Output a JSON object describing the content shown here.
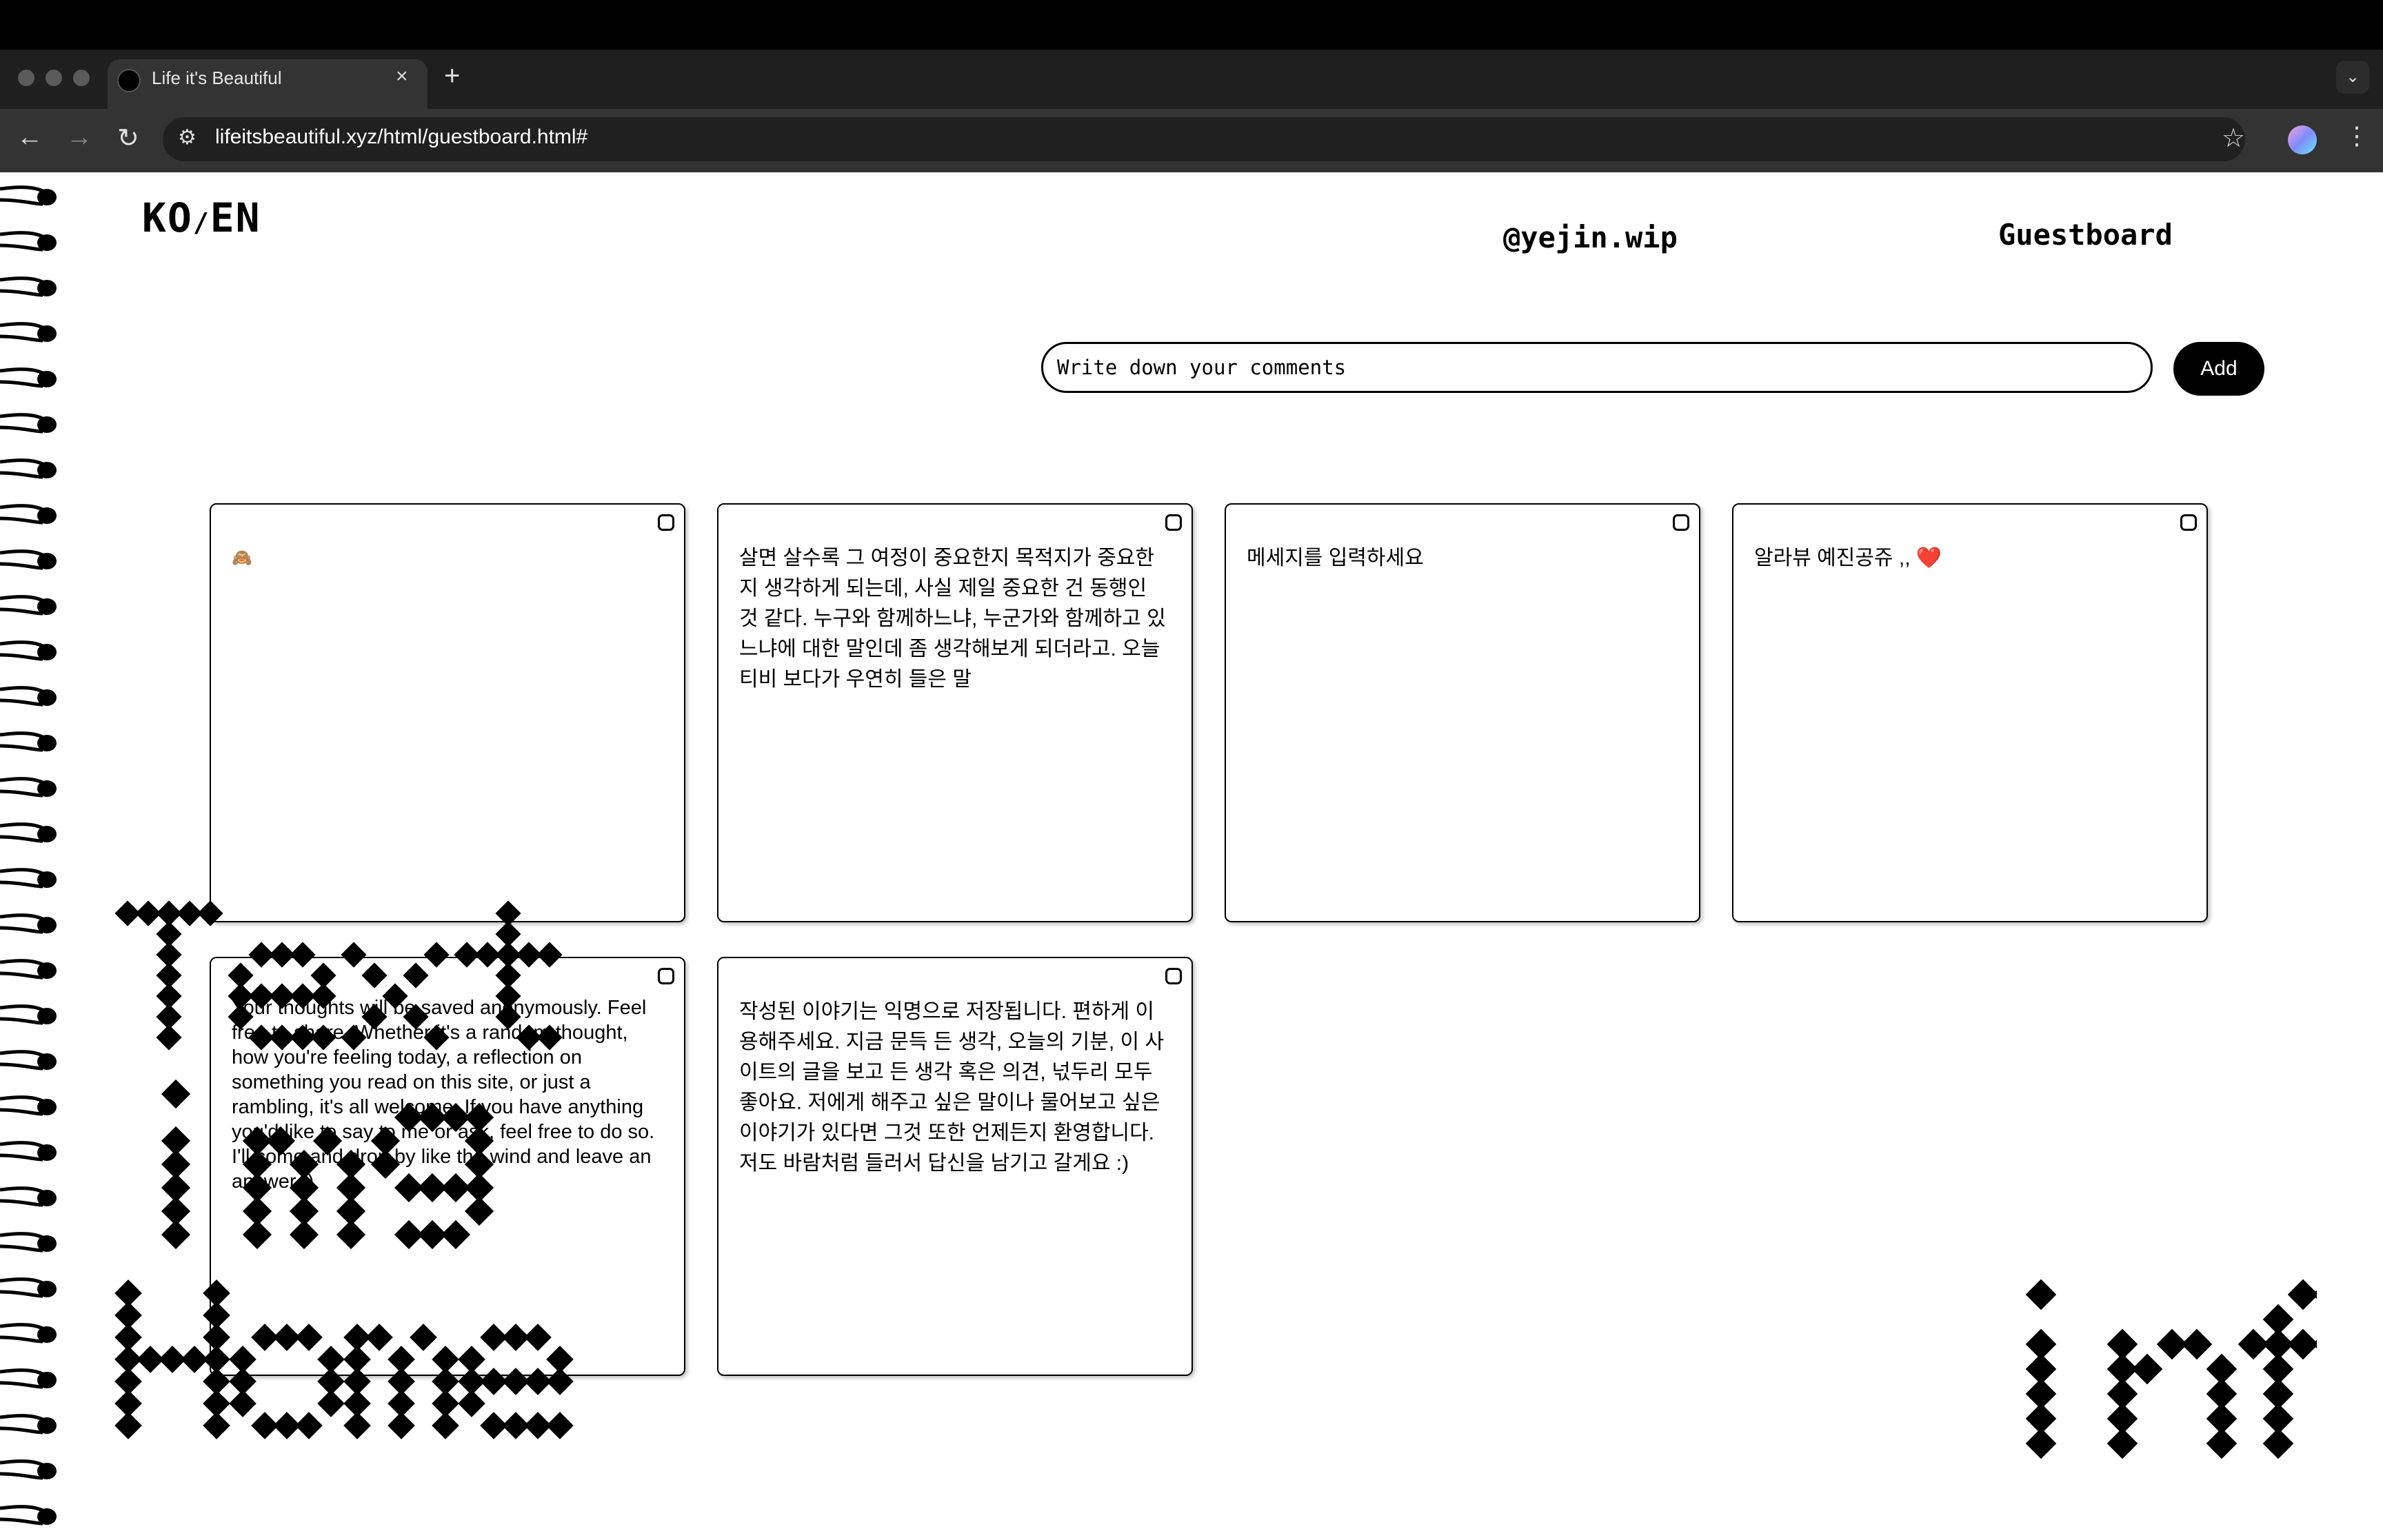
{
  "browser": {
    "tab_title": "Life it's Beautiful",
    "tab_close": "×",
    "new_tab": "+",
    "tab_menu": "⌄",
    "back": "←",
    "forward": "→",
    "reload": "↻",
    "site_info": "⚙",
    "url": "lifeitsbeautiful.xyz/html/guestboard.html#",
    "bookmark": "☆",
    "menu": "⋮"
  },
  "header": {
    "lang_ko": "KO",
    "lang_sep": "/",
    "lang_en": "EN",
    "handle": "@yejin.wip",
    "guestboard": "Guestboard"
  },
  "form": {
    "placeholder": "Write down your comments",
    "add_label": "Add"
  },
  "cards": [
    {
      "text": "🙈"
    },
    {
      "text": "살면 살수록 그 여정이 중요한지 목적지가 중요한지 생각하게 되는데, 사실 제일 중요한 건 동행인 것 같다. 누구와 함께하느냐, 누군가와 함께하고 있느냐에 대한 말인데 좀 생각해보게 되더라고. 오늘 티비 보다가 우연히 들은 말"
    },
    {
      "text": "메세지를 입력하세요"
    },
    {
      "text": "알라뷰 예진공쥬 ,, ❤️"
    },
    {
      "text": "Your thoughts will be saved anonymously. Feel free to share. Whether it's a random thought, how you're feeling today, a reflection on something you read on this site, or just a rambling, it's all welcome. If you have anything you'd like to say to me or ask, feel free to do so. I'll come and drop by like the wind and leave an answer :)"
    },
    {
      "text": "작성된 이야기는 익명으로 저장됩니다. 편하게 이용해주세요. 지금 문득 든 생각, 오늘의 기분, 이 사이트의 글을 보고 든 생각 혹은 의견, 넋두리 모두 좋아요. 저에게 해주고 싶은 말이나 물어보고 싶은 이야기가 있다면 그것 또한 언제든지 환영합니다. 저도 바람처럼 들러서 답신을 남기고 갈게요 :)"
    }
  ],
  "decor": {
    "left_words": [
      "Text",
      "img",
      "Home"
    ],
    "right_word": "info"
  }
}
